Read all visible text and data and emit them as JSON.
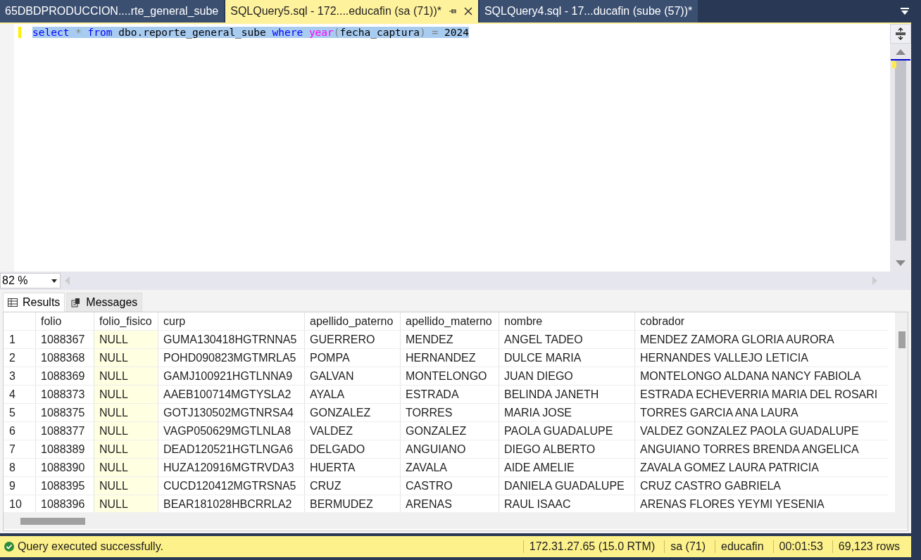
{
  "tabs": [
    {
      "label": "65DBDPRODUCCION....rte_general_sube",
      "selected": false
    },
    {
      "label": "SQLQuery5.sql - 172....educafin (sa (71))*",
      "selected": true
    },
    {
      "label": "SQLQuery4.sql - 17...ducafin (sube (57))*",
      "selected": false
    }
  ],
  "editor": {
    "tokens": [
      {
        "text": "select",
        "kind": "keyword"
      },
      {
        "text": " * ",
        "kind": "operator"
      },
      {
        "text": "from",
        "kind": "keyword"
      },
      {
        "text": " dbo.reporte_general_sube ",
        "kind": "identifier"
      },
      {
        "text": "where",
        "kind": "keyword"
      },
      {
        "text": " year",
        "kind": "function"
      },
      {
        "text": "(",
        "kind": "operator"
      },
      {
        "text": "fecha_captura",
        "kind": "identifier"
      },
      {
        "text": ") = ",
        "kind": "operator"
      },
      {
        "text": "2024",
        "kind": "identifier"
      }
    ]
  },
  "zoom": "82 %",
  "result_tabs": [
    {
      "label": "Results",
      "selected": true
    },
    {
      "label": "Messages",
      "selected": false
    }
  ],
  "table": {
    "columns": [
      "",
      "folio",
      "folio_fisico",
      "curp",
      "apellido_paterno",
      "apellido_materno",
      "nombre",
      "cobrador"
    ],
    "rows": [
      [
        "1",
        "1088367",
        "NULL",
        "GUMA130418HGTRNNA5",
        "GUERRERO",
        "MENDEZ",
        "ANGEL TADEO",
        "MENDEZ ZAMORA GLORIA AURORA"
      ],
      [
        "2",
        "1088368",
        "NULL",
        "POHD090823MGTMRLA5",
        "POMPA",
        "HERNANDEZ",
        "DULCE MARIA",
        "HERNANDES VALLEJO LETICIA"
      ],
      [
        "3",
        "1088369",
        "NULL",
        "GAMJ100921HGTLNNA9",
        "GALVAN",
        "MONTELONGO",
        "JUAN DIEGO",
        "MONTELONGO ALDANA NANCY FABIOLA"
      ],
      [
        "4",
        "1088373",
        "NULL",
        "AAEB100714MGTYSLA2",
        "AYALA",
        "ESTRADA",
        "BELINDA JANETH",
        "ESTRADA ECHEVERRIA MARIA DEL ROSARI"
      ],
      [
        "5",
        "1088375",
        "NULL",
        "GOTJ130502MGTNRSA4",
        "GONZALEZ",
        "TORRES",
        "MARIA JOSE",
        "TORRES GARCIA ANA LAURA"
      ],
      [
        "6",
        "1088377",
        "NULL",
        "VAGP050629MGTLNLA8",
        "VALDEZ",
        "GONZALEZ",
        "PAOLA GUADALUPE",
        "VALDEZ GONZALEZ PAOLA GUADALUPE"
      ],
      [
        "7",
        "1088389",
        "NULL",
        "DEAD120521HGTLNGA6",
        "DELGADO",
        "ANGUIANO",
        "DIEGO ALBERTO",
        "ANGUIANO TORRES BRENDA ANGELICA"
      ],
      [
        "8",
        "1088390",
        "NULL",
        "HUZA120916MGTRVDA3",
        "HUERTA",
        "ZAVALA",
        "AIDE AMELIE",
        "ZAVALA GOMEZ LAURA PATRICIA"
      ],
      [
        "9",
        "1088395",
        "NULL",
        "CUCD120412MGTRSNA5",
        "CRUZ",
        "CASTRO",
        "DANIELA GUADALUPE",
        "CRUZ CASTRO GABRIELA"
      ],
      [
        "10",
        "1088396",
        "NULL",
        "BEAR181028HBCRRLA2",
        "BERMUDEZ",
        "ARENAS",
        "RAUL ISAAC",
        "ARENAS FLORES YEYMI YESENIA"
      ]
    ]
  },
  "status": {
    "message": "Query executed successfully.",
    "server": "172.31.27.65 (15.0 RTM)",
    "user": "sa (71)",
    "database": "educafin",
    "elapsed": "00:01:53",
    "rows": "69,123 rows"
  }
}
